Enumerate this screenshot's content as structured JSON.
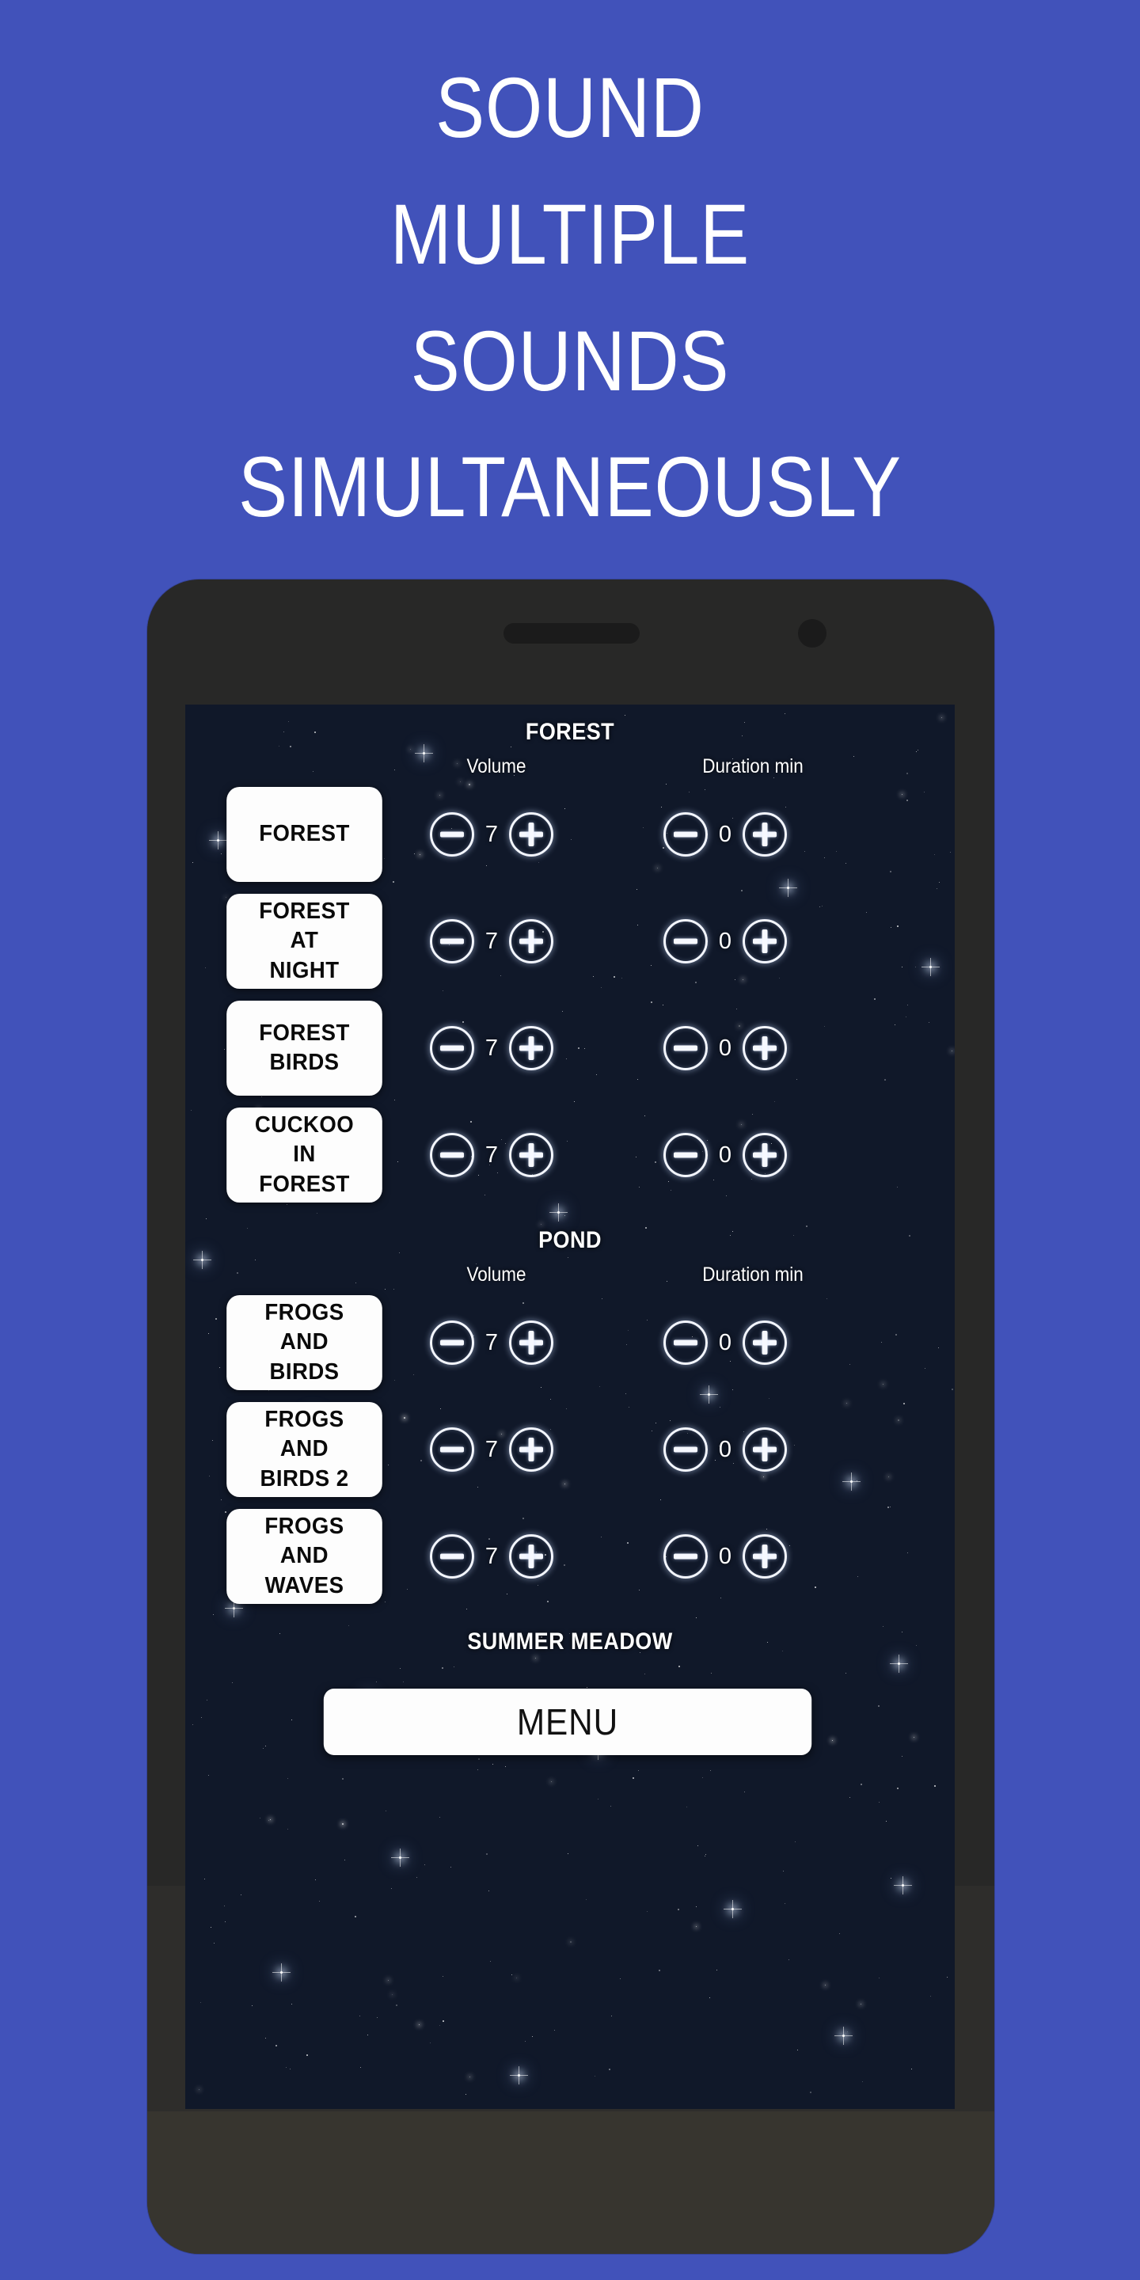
{
  "promo": {
    "background_color": "#4152ba",
    "headline": "SOUND\nMULTIPLE\nSOUNDS\nSIMULTANEOUSLY"
  },
  "device": {
    "frame_color": "#2e2d2b",
    "speaker_icon": "speaker-grille-icon",
    "camera_icon": "front-camera-icon"
  },
  "app": {
    "screen_background_color": "#101829",
    "column_labels": {
      "volume": "Volume",
      "duration": "Duration min"
    },
    "controls": {
      "decrement_icon": "minus-circle-icon",
      "increment_icon": "plus-circle-icon"
    },
    "sections": [
      {
        "title": "FOREST",
        "rows": [
          {
            "name": "FOREST",
            "volume": "7",
            "duration": "0"
          },
          {
            "name": "FOREST\nAT\nNIGHT",
            "volume": "7",
            "duration": "0"
          },
          {
            "name": "FOREST\nBIRDS",
            "volume": "7",
            "duration": "0"
          },
          {
            "name": "CUCKOO\nIN\nFOREST",
            "volume": "7",
            "duration": "0"
          }
        ]
      },
      {
        "title": "POND",
        "rows": [
          {
            "name": "FROGS\nAND\nBIRDS",
            "volume": "7",
            "duration": "0"
          },
          {
            "name": "FROGS\nAND\nBIRDS 2",
            "volume": "7",
            "duration": "0"
          },
          {
            "name": "FROGS\nAND\nWAVES",
            "volume": "7",
            "duration": "0"
          }
        ]
      },
      {
        "title": "SUMMER MEADOW",
        "rows": []
      }
    ],
    "menu_button": "MENU"
  }
}
